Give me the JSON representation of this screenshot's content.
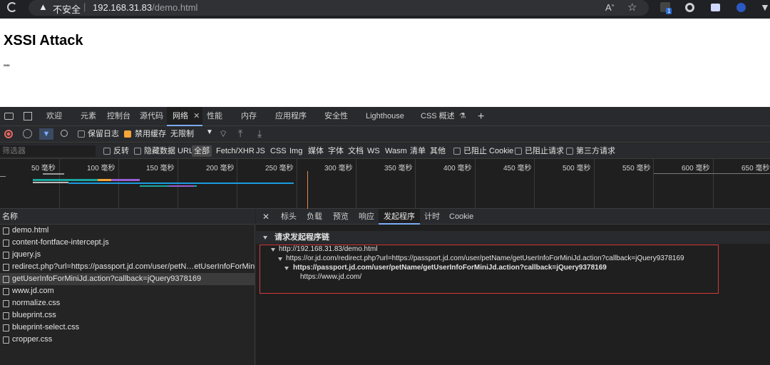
{
  "browser": {
    "security_label": "不安全",
    "url_host": "192.168.31.83",
    "url_path": "/demo.html",
    "badge_count": "1"
  },
  "page": {
    "title": "XSSI Attack",
    "output": "\"\""
  },
  "devtools": {
    "tabs": [
      "欢迎",
      "元素",
      "控制台",
      "源代码",
      "网络",
      "性能",
      "内存",
      "应用程序",
      "安全性",
      "Lighthouse",
      "CSS 概述"
    ],
    "active_tab": "网络",
    "toolbar": {
      "preserve_log": "保留日志",
      "disable_cache": "禁用缓存",
      "throttling": "无限制"
    },
    "filter": {
      "placeholder": "筛选器",
      "invert": "反转",
      "hide_data_urls": "隐藏数据 URL",
      "types": [
        "全部",
        "Fetch/XHR",
        "JS",
        "CSS",
        "Img",
        "媒体",
        "字体",
        "文档",
        "WS",
        "Wasm",
        "清单",
        "其他"
      ],
      "blocked_cookies": "已阻止 Cookie",
      "blocked_requests": "已阻止请求",
      "third_party": "第三方请求"
    },
    "timeline_ticks": [
      "50 毫秒",
      "100 毫秒",
      "150 毫秒",
      "200 毫秒",
      "250 毫秒",
      "300 毫秒",
      "350 毫秒",
      "400 毫秒",
      "450 毫秒",
      "500 毫秒",
      "550 毫秒",
      "600 毫秒",
      "650 毫秒"
    ],
    "requests_header": "名称",
    "requests": [
      "demo.html",
      "content-fontface-intercept.js",
      "jquery.js",
      "redirect.php?url=https://passport.jd.com/user/petN…etUserInfoForMiniJd…",
      "getUserInfoForMiniJd.action?callback=jQuery9378169",
      "www.jd.com",
      "normalize.css",
      "blueprint.css",
      "blueprint-select.css",
      "cropper.css"
    ],
    "selected_request": 4,
    "detail_tabs": [
      "标头",
      "负载",
      "预览",
      "响应",
      "发起程序",
      "计时",
      "Cookie"
    ],
    "detail_active": "发起程序",
    "initiator": {
      "section_title": "请求发起程序链",
      "chain": [
        "http://192.168.31.83/demo.html",
        "https://or.jd.com/redirect.php?url=https://passport.jd.com/user/petName/getUserInfoForMiniJd.action?callback=jQuery9378169",
        "https://passport.jd.com/user/petName/getUserInfoForMiniJd.action?callback=jQuery9378169",
        "https://www.jd.com/"
      ]
    }
  }
}
